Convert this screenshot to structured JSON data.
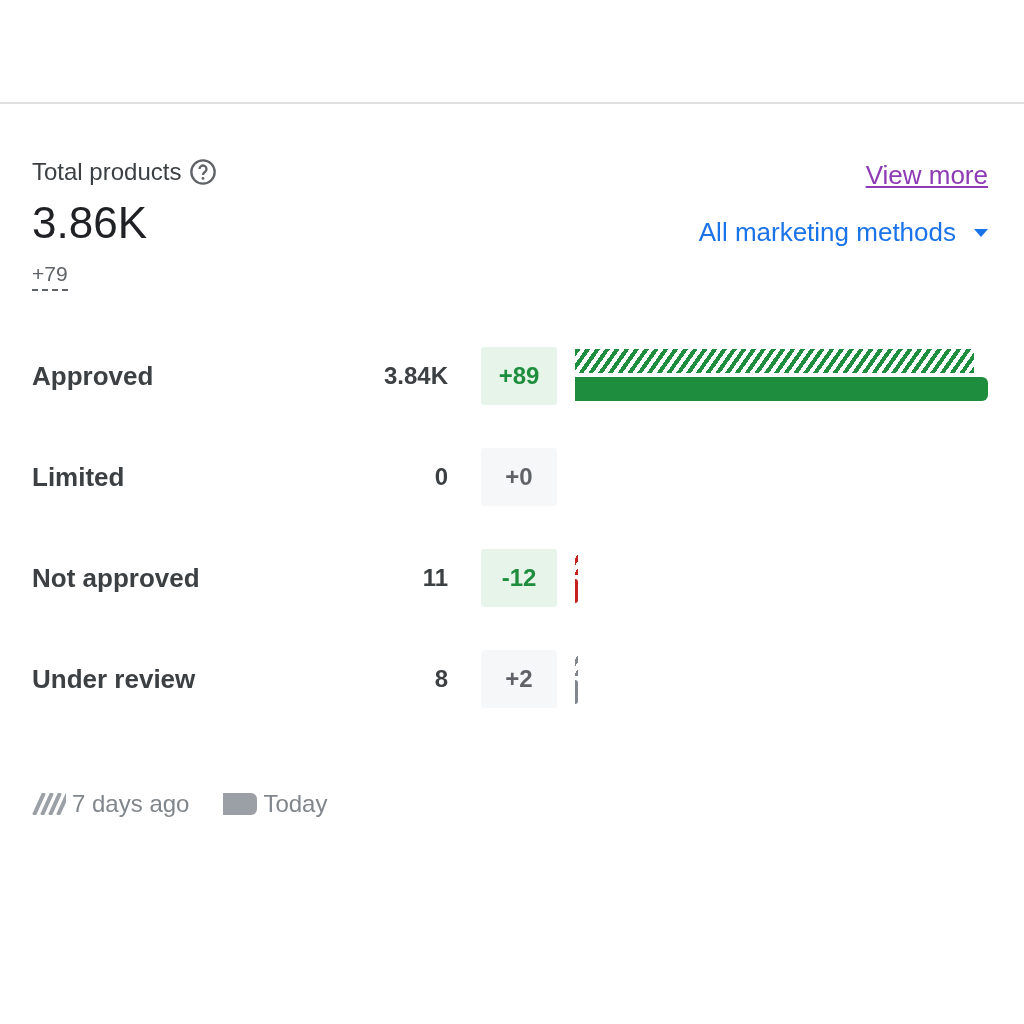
{
  "summary": {
    "title": "Total products",
    "total": "3.86K",
    "change": "+79"
  },
  "view_more": "View more",
  "filter": {
    "label": "All marketing methods"
  },
  "rows": [
    {
      "label": "Approved",
      "count": "3.84K",
      "change": "+89",
      "improved": true,
      "kind": "full",
      "color": "#1e8e3e"
    },
    {
      "label": "Limited",
      "count": "0",
      "change": "+0",
      "improved": false
    },
    {
      "label": "Not approved",
      "count": "11",
      "change": "-12",
      "improved": true,
      "kind": "sliver",
      "color": "#c5221f"
    },
    {
      "label": "Under review",
      "count": "8",
      "change": "+2",
      "improved": false,
      "kind": "sliver",
      "color": "#80868b"
    }
  ],
  "legend": [
    {
      "kind": "previous",
      "label": "7 days ago"
    },
    {
      "kind": "today",
      "label": "Today"
    }
  ]
}
